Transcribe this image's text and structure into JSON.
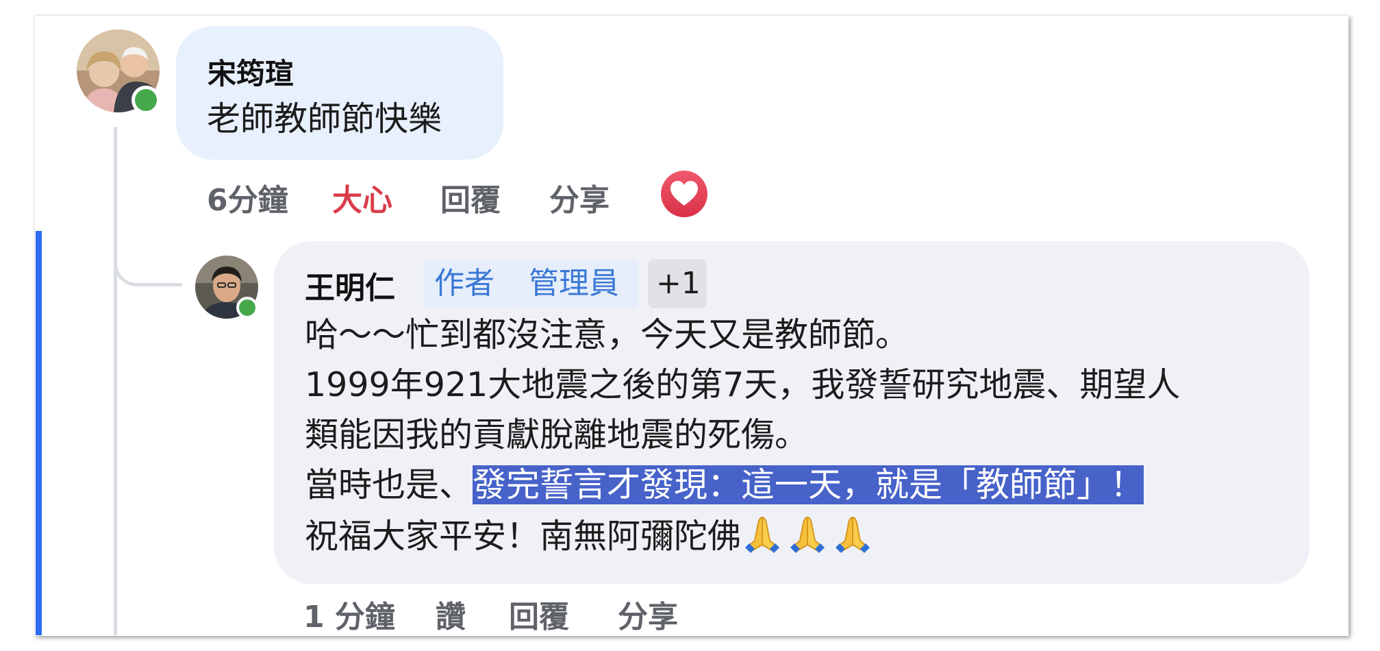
{
  "comment_1": {
    "author": "宋筠瑄",
    "text": "老師教師節快樂",
    "time": "6分鐘",
    "reaction_label": "大心",
    "reply_label": "回覆",
    "share_label": "分享",
    "reaction_icon": "heart-love-icon"
  },
  "comment_2": {
    "author": "王明仁",
    "badges": [
      "作者",
      "管理員",
      "+1"
    ],
    "lines": {
      "l1": "哈～～忙到都沒注意，今天又是教師節。",
      "l2": "1999年921大地震之後的第7天，我發誓研究地震、期望人",
      "l3": "類能因我的貢獻脫離地震的死傷。",
      "l4_plain": "當時也是、",
      "l4_highlight": "發完誓言才發現：這一天，就是「教師節」！",
      "l5": "祝福大家平安！南無阿彌陀佛"
    },
    "emoji": [
      "folded-hands-icon",
      "folded-hands-icon",
      "folded-hands-icon"
    ],
    "time": "1 分鐘",
    "like_label": "讚",
    "reply_label": "回覆",
    "share_label": "分享"
  },
  "colors": {
    "accent_bar": "#2f6cf0",
    "love_red": "#e4445a",
    "online_green": "#45a84a",
    "highlight_bg": "#4762c9",
    "badge_blue": "#3a78d6"
  }
}
